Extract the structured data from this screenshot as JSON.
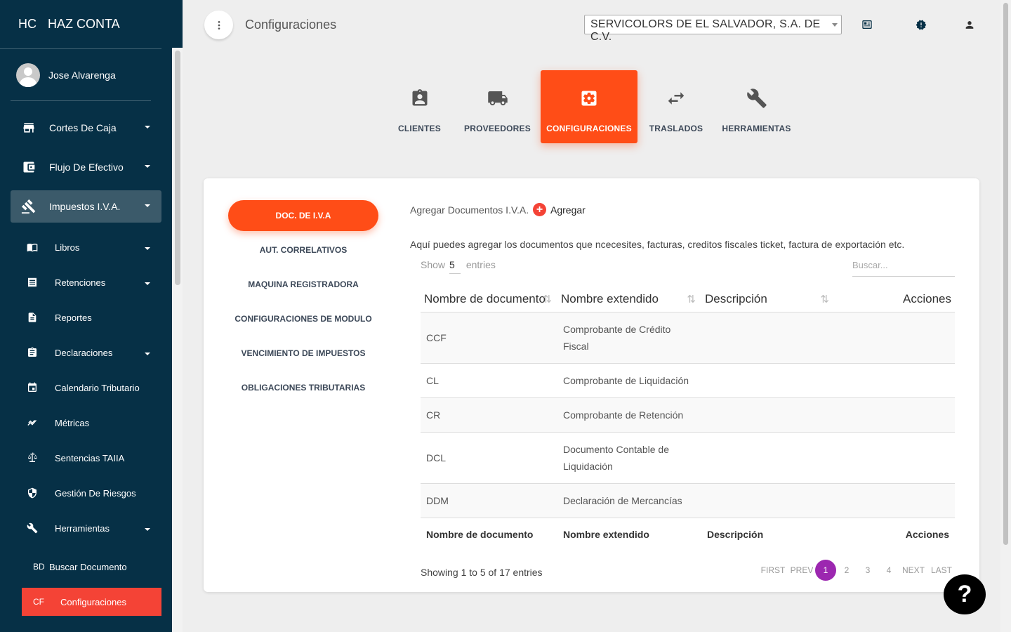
{
  "brand": {
    "mini": "HC",
    "name": "HAZ CONTA"
  },
  "user": {
    "name": "Jose Alvarenga"
  },
  "sidebar": {
    "items": [
      {
        "label": "Cortes De Caja",
        "icon": "store-icon"
      },
      {
        "label": "Flujo De Efectivo",
        "icon": "wallet-icon"
      },
      {
        "label": "Impuestos I.V.A.",
        "icon": "gavel-icon"
      }
    ],
    "sub_items": [
      {
        "label": "Libros",
        "icon": "book-icon"
      },
      {
        "label": "Retenciones",
        "icon": "receipt-icon"
      },
      {
        "label": "Reportes",
        "icon": "document-icon"
      },
      {
        "label": "Declaraciones",
        "icon": "clipboard-icon"
      },
      {
        "label": "Calendario Tributario",
        "icon": "calendar-icon"
      },
      {
        "label": "Métricas",
        "icon": "trend-icon"
      },
      {
        "label": "Sentencias TAIIA",
        "icon": "balance-icon"
      },
      {
        "label": "Gestión De Riesgos",
        "icon": "shield-icon"
      },
      {
        "label": "Herramientas",
        "icon": "wrench-icon"
      }
    ],
    "mini_items": [
      {
        "mini": "BD",
        "label": "Buscar Documento"
      },
      {
        "mini": "CF",
        "label": "Configuraciones"
      }
    ]
  },
  "header": {
    "title": "Configuraciones",
    "company": "SERVICOLORS DE EL SALVADOR, S.A. DE C.V."
  },
  "tabs": [
    {
      "label": "CLIENTES",
      "icon": "badge-icon"
    },
    {
      "label": "PROVEEDORES",
      "icon": "truck-icon"
    },
    {
      "label": "CONFIGURACIONES",
      "icon": "settings-box-icon"
    },
    {
      "label": "TRASLADOS",
      "icon": "swap-icon"
    },
    {
      "label": "HERRAMIENTAS",
      "icon": "wrench-icon"
    }
  ],
  "left_nav": {
    "active": "DOC. DE I.V.A",
    "links": [
      "AUT. CORRELATIVOS",
      "MAQUINA REGISTRADORA",
      "CONFIGURACIONES DE MODULO",
      "VENCIMIENTO DE IMPUESTOS",
      "OBLIGACIONES TRIBUTARIAS"
    ]
  },
  "content": {
    "add_label": "Agregar Documentos I.V.A.",
    "add_button": "Agregar",
    "description": "Aquí puedes agregar los documentos que ncecesites, facturas, creditos fiscales ticket, factura de exportación etc.",
    "show_pre": "Show",
    "show_value": "5",
    "show_post": "entries",
    "search_placeholder": "Buscar..."
  },
  "table": {
    "headers": [
      "Nombre de documento",
      "Nombre extendido",
      "Descripción",
      "Acciones"
    ],
    "rows": [
      [
        "CCF",
        "Comprobante de Crédito Fiscal",
        "",
        ""
      ],
      [
        "CL",
        "Comprobante de Liquidación",
        "",
        ""
      ],
      [
        "CR",
        "Comprobante de Retención",
        "",
        ""
      ],
      [
        "DCL",
        "Documento Contable de Liquidación",
        "",
        ""
      ],
      [
        "DDM",
        "Declaración de Mercancías",
        "",
        ""
      ]
    ],
    "footer": [
      "Nombre de documento",
      "Nombre extendido",
      "Descripción",
      "Acciones"
    ]
  },
  "pagination": {
    "info": "Showing 1 to 5 of 17 entries",
    "first": "FIRST",
    "prev": "PREV",
    "pages": [
      "1",
      "2",
      "3",
      "4"
    ],
    "next": "NEXT",
    "last": "LAST",
    "current": "1"
  },
  "help": "?",
  "colors": {
    "sidebar": "#063046",
    "accent": "#ff4d17",
    "active_red": "#f44336",
    "page_current": "#9c27b0"
  }
}
